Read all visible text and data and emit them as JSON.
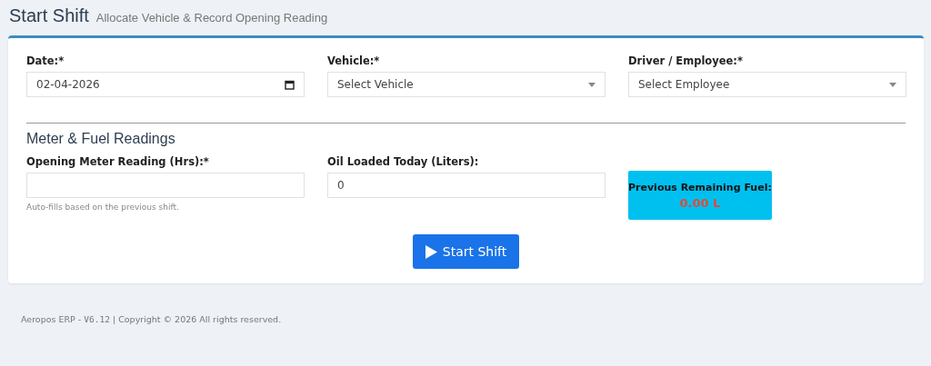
{
  "header": {
    "title": "Start Shift",
    "subtitle": "Allocate Vehicle & Record Opening Reading"
  },
  "top_fields": [
    {
      "kind": "date",
      "label": "Date:*",
      "value": "02-04-2026"
    },
    {
      "kind": "select",
      "label": "Vehicle:*",
      "value": "Select Vehicle"
    },
    {
      "kind": "select",
      "label": "Driver / Employee:*",
      "value": "Select Employee"
    }
  ],
  "section_title": "Meter & Fuel Readings",
  "meter_field": {
    "label": "Opening Meter Reading (Hrs):*",
    "help": "Auto-fills based on the previous shift."
  },
  "oil_field": {
    "label": "Oil Loaded Today (Liters):",
    "value": "0"
  },
  "fuel_panel": {
    "label": "Previous Remaining Fuel:",
    "value": "0.00 L"
  },
  "submit_button": "Start Shift",
  "footer": {
    "brand": "Aeropos ERP - ",
    "version": "V6.12",
    "copyright": " | Copyright © 2026 All rights reserved."
  }
}
